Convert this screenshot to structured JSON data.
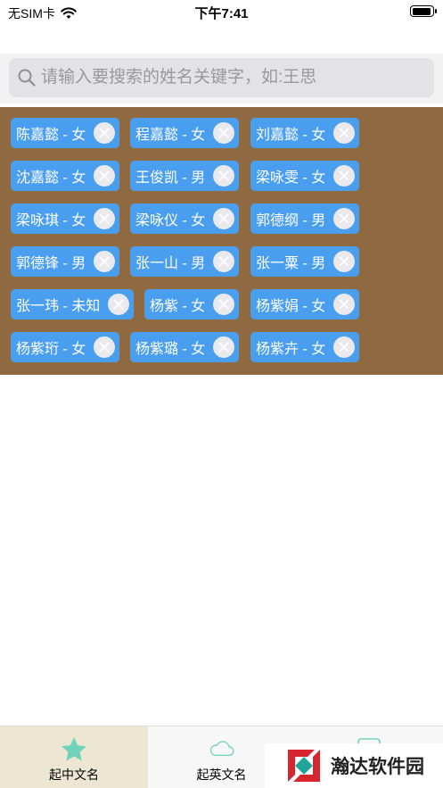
{
  "status_bar": {
    "carrier": "无SIM卡",
    "time": "下午7:41",
    "battery_level": 0.95
  },
  "search": {
    "placeholder": "请输入要搜索的姓名关键字，如:王思"
  },
  "tags": [
    {
      "label": "陈嘉懿 - 女"
    },
    {
      "label": "程嘉懿 - 女"
    },
    {
      "label": "刘嘉懿 - 女"
    },
    {
      "label": "沈嘉懿 - 女"
    },
    {
      "label": "王俊凯 - 男"
    },
    {
      "label": "梁咏雯 - 女"
    },
    {
      "label": "梁咏琪 - 女"
    },
    {
      "label": "梁咏仪 - 女"
    },
    {
      "label": "郭德纲 - 男"
    },
    {
      "label": "郭德锋 - 男"
    },
    {
      "label": "张一山 - 男"
    },
    {
      "label": "张一粟 - 男"
    },
    {
      "label": "张一玮 - 未知"
    },
    {
      "label": "杨紫 - 女"
    },
    {
      "label": "杨紫娟 - 女"
    },
    {
      "label": "杨紫珩 - 女"
    },
    {
      "label": "杨紫璐 - 女"
    },
    {
      "label": "杨紫卉 - 女"
    }
  ],
  "tabbar": {
    "tabs": [
      {
        "label": "起中文名",
        "icon": "star-icon",
        "selected": true
      },
      {
        "label": "起英文名",
        "icon": "cloud-icon",
        "selected": false
      },
      {
        "label": "",
        "icon": "tab3-icon",
        "selected": false
      }
    ]
  },
  "watermark": {
    "text": "瀚达软件园"
  },
  "colors": {
    "tag_background": "#4a9ef0",
    "tags_area_background": "#8f6a40",
    "selected_tab_background": "#ede6d3",
    "star_color": "#6ed3b8"
  }
}
